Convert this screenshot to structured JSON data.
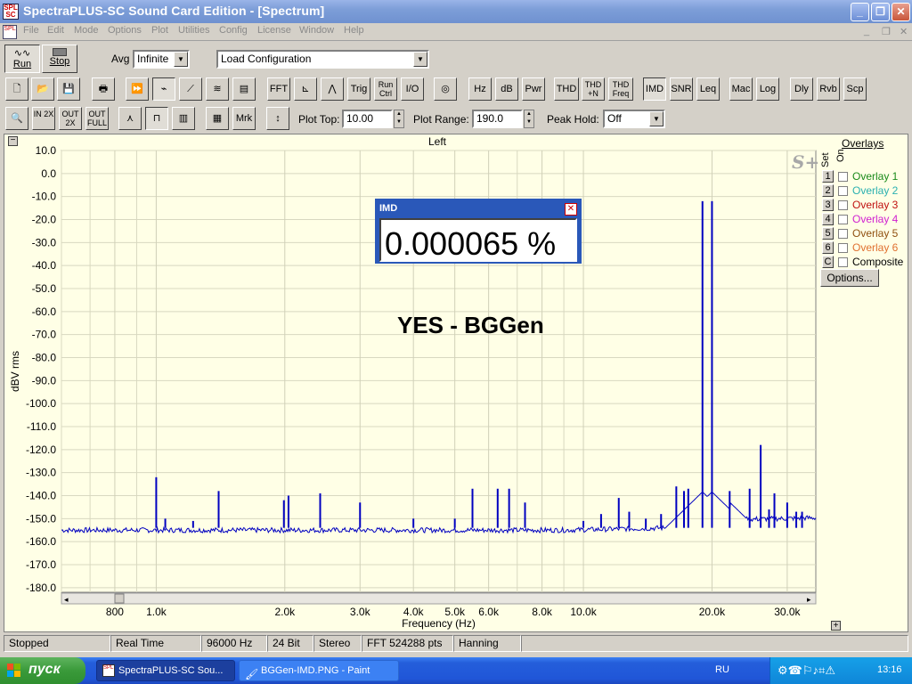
{
  "window": {
    "title": "SpectraPLUS-SC Sound Card Edition - [Spectrum]"
  },
  "menu": [
    "File",
    "Edit",
    "Mode",
    "Options",
    "Plot",
    "Utilities",
    "Config",
    "License",
    "Window",
    "Help"
  ],
  "toolbar1": {
    "run": "Run",
    "stop": "Stop",
    "avg_label": "Avg",
    "avg_value": "Infinite",
    "config_value": "Load Configuration"
  },
  "toolbar2": [
    "FFT",
    "Trig",
    "Run Ctrl",
    "I/O",
    "Hz",
    "dB",
    "Pwr",
    "THD",
    "THD +N",
    "THD Freq",
    "IMD",
    "SNR",
    "Leq",
    "Mac",
    "Log",
    "Dly",
    "Rvb",
    "Scp"
  ],
  "toolbar3": {
    "mrk": "Mrk",
    "plot_top_label": "Plot Top:",
    "plot_top_value": "10.00",
    "plot_range_label": "Plot Range:",
    "plot_range_value": "190.0",
    "peak_hold_label": "Peak Hold:",
    "peak_hold_value": "Off"
  },
  "plot": {
    "channel": "Left",
    "watermark": "S+",
    "annotation": "YES - BGGen",
    "collapse": "−",
    "expand": "+"
  },
  "overlays": {
    "title": "Overlays",
    "set_label": "Set",
    "on_label": "On",
    "items": [
      {
        "set": "1",
        "name": "Overlay 1",
        "color": "#1a8a1a"
      },
      {
        "set": "2",
        "name": "Overlay 2",
        "color": "#2ab0b0"
      },
      {
        "set": "3",
        "name": "Overlay 3",
        "color": "#c01010"
      },
      {
        "set": "4",
        "name": "Overlay 4",
        "color": "#d020d0"
      },
      {
        "set": "5",
        "name": "Overlay 5",
        "color": "#905010"
      },
      {
        "set": "6",
        "name": "Overlay 6",
        "color": "#e07030"
      },
      {
        "set": "C",
        "name": "Composite",
        "color": "#000000"
      }
    ],
    "options_label": "Options..."
  },
  "imd": {
    "title": "IMD",
    "value": "0.000065 %"
  },
  "status": [
    "Stopped",
    "Real Time",
    "96000 Hz",
    "24 Bit",
    "Stereo",
    "FFT 524288 pts",
    "Hanning"
  ],
  "taskbar": {
    "start": "пуск",
    "tasks": [
      "SpectraPLUS-SC Sou...",
      "BGGen-IMD.PNG - Paint"
    ],
    "lang": "RU",
    "time": "13:16"
  },
  "chart_data": {
    "type": "line",
    "title": "",
    "xlabel": "Frequency (Hz)",
    "ylabel": "dBV rms",
    "xscale": "log",
    "xlim": [
      600,
      35000
    ],
    "ylim": [
      -182,
      10
    ],
    "y_ticks": [
      "10.0",
      "0.0",
      "-10.0",
      "-20.0",
      "-30.0",
      "-40.0",
      "-50.0",
      "-60.0",
      "-70.0",
      "-80.0",
      "-90.0",
      "-100.0",
      "-110.0",
      "-120.0",
      "-130.0",
      "-140.0",
      "-150.0",
      "-160.0",
      "-170.0",
      "-180.0"
    ],
    "x_ticks": [
      {
        "v": 800,
        "label": "800"
      },
      {
        "v": 1000,
        "label": "1.0k"
      },
      {
        "v": 2000,
        "label": "2.0k"
      },
      {
        "v": 3000,
        "label": "3.0k"
      },
      {
        "v": 4000,
        "label": "4.0k"
      },
      {
        "v": 5000,
        "label": "5.0k"
      },
      {
        "v": 6000,
        "label": "6.0k"
      },
      {
        "v": 8000,
        "label": "8.0k"
      },
      {
        "v": 10000,
        "label": "10.0k"
      },
      {
        "v": 20000,
        "label": "20.0k"
      },
      {
        "v": 30000,
        "label": "30.0k"
      }
    ],
    "minor_x": [
      600,
      700,
      900,
      7000,
      9000,
      40000
    ],
    "noise_floor": -155,
    "series": [
      {
        "color": "#0000c0",
        "spikes": [
          {
            "x": 1000,
            "y": -132
          },
          {
            "x": 1050,
            "y": -150
          },
          {
            "x": 1220,
            "y": -151
          },
          {
            "x": 1400,
            "y": -138
          },
          {
            "x": 1990,
            "y": -142
          },
          {
            "x": 2040,
            "y": -140
          },
          {
            "x": 2420,
            "y": -139
          },
          {
            "x": 3000,
            "y": -143
          },
          {
            "x": 4000,
            "y": -150
          },
          {
            "x": 5000,
            "y": -150
          },
          {
            "x": 5500,
            "y": -137
          },
          {
            "x": 6300,
            "y": -137
          },
          {
            "x": 6700,
            "y": -137
          },
          {
            "x": 7300,
            "y": -143
          },
          {
            "x": 10000,
            "y": -151
          },
          {
            "x": 11000,
            "y": -148
          },
          {
            "x": 12100,
            "y": -141
          },
          {
            "x": 12800,
            "y": -147
          },
          {
            "x": 14000,
            "y": -150
          },
          {
            "x": 15200,
            "y": -148
          },
          {
            "x": 16500,
            "y": -136
          },
          {
            "x": 17200,
            "y": -138
          },
          {
            "x": 17600,
            "y": -137
          },
          {
            "x": 19000,
            "y": -12
          },
          {
            "x": 20000,
            "y": -12
          },
          {
            "x": 22000,
            "y": -138
          },
          {
            "x": 24500,
            "y": -137
          },
          {
            "x": 26000,
            "y": -118
          },
          {
            "x": 27200,
            "y": -146
          },
          {
            "x": 28000,
            "y": -139
          },
          {
            "x": 30000,
            "y": -143
          },
          {
            "x": 31500,
            "y": -147
          },
          {
            "x": 32500,
            "y": -147
          }
        ]
      }
    ]
  }
}
